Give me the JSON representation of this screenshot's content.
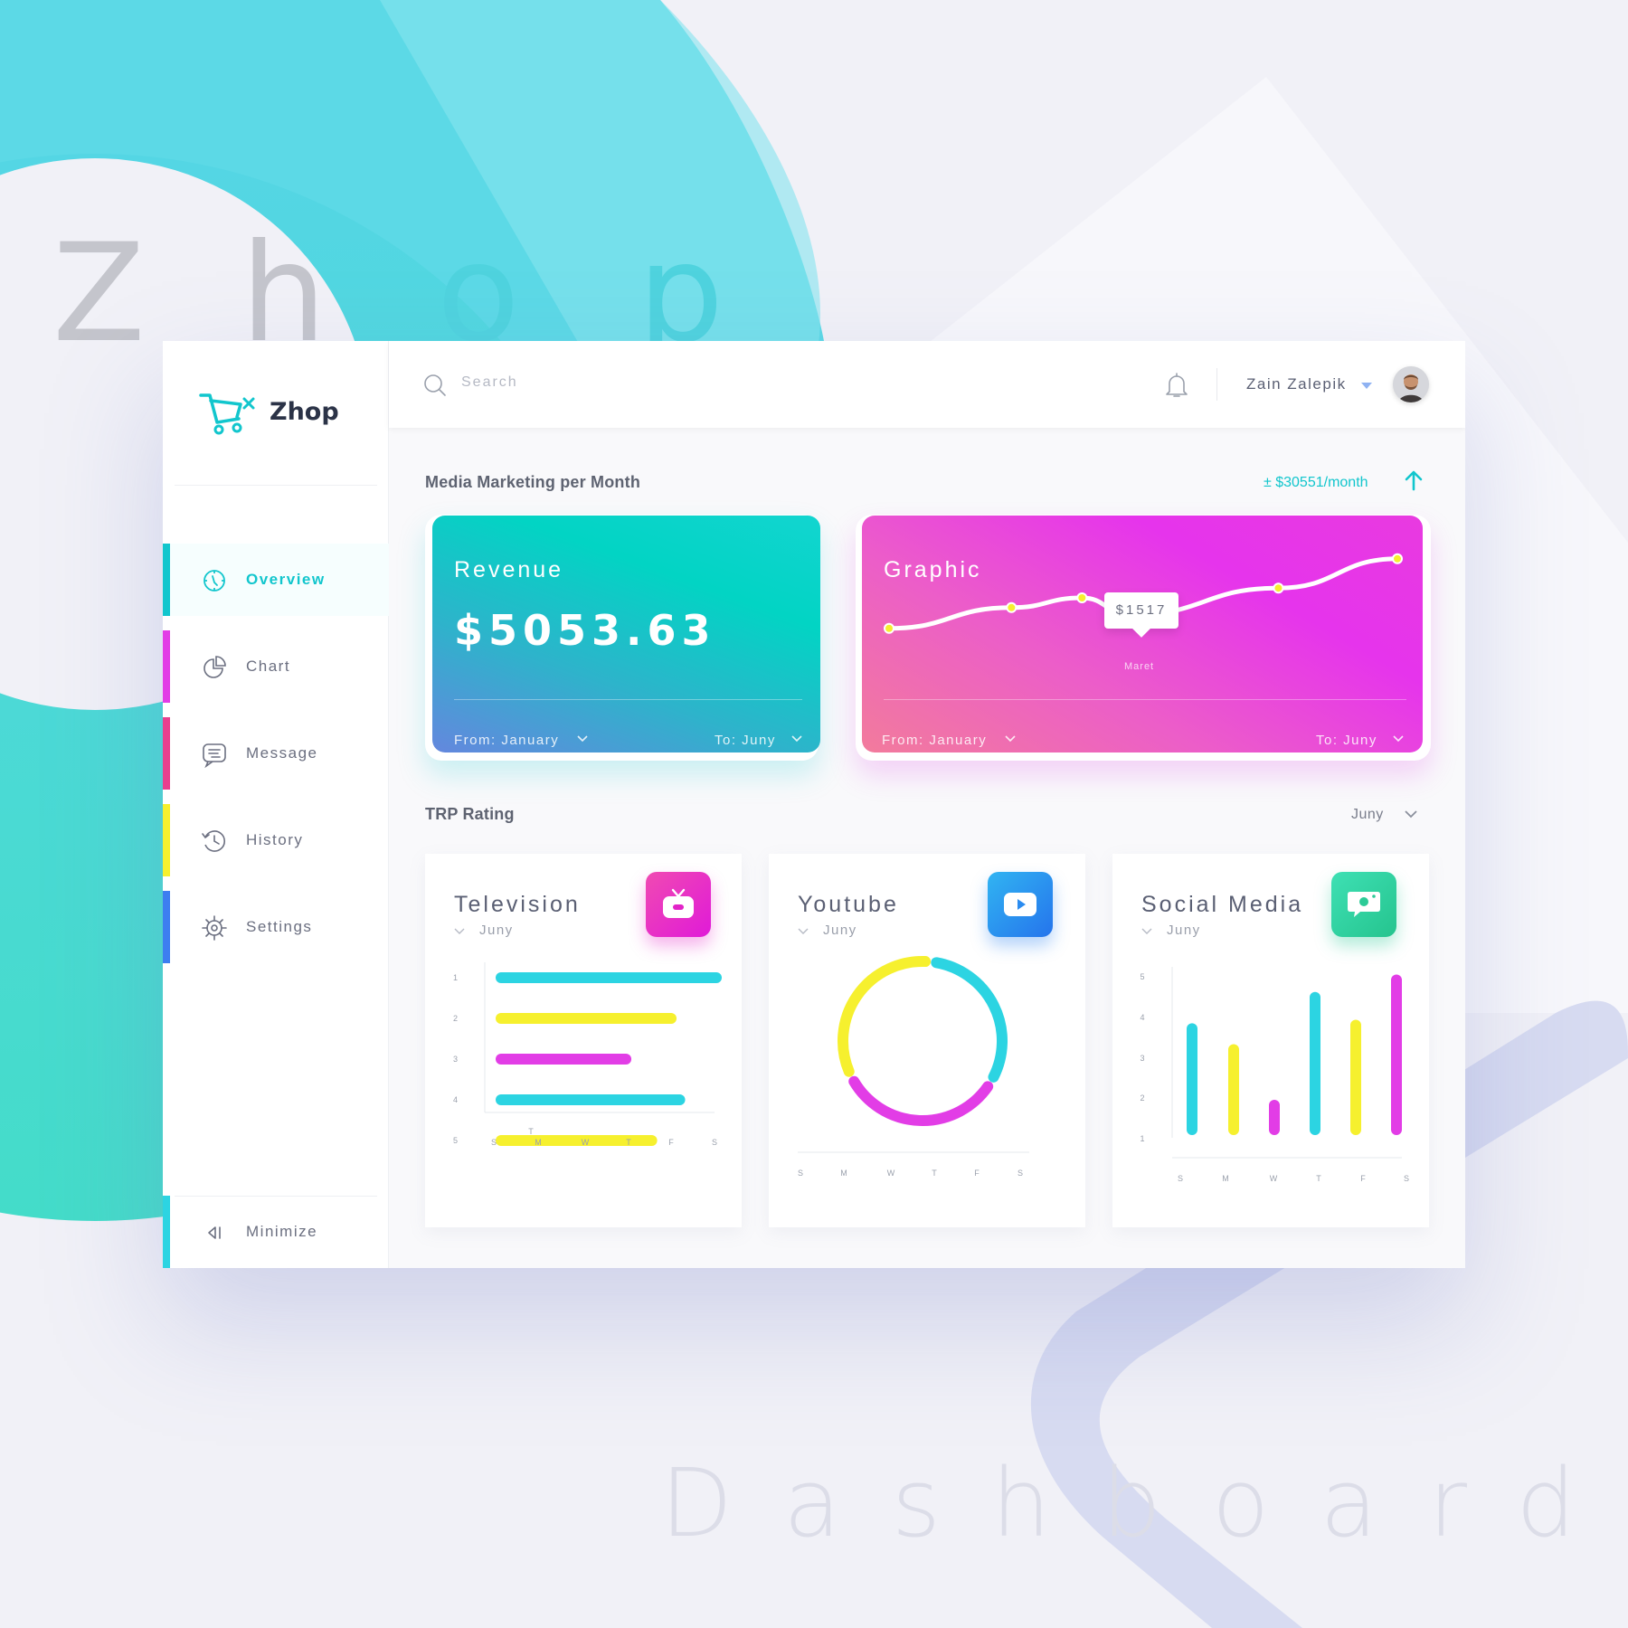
{
  "backdrop": {
    "brand_letters": [
      "Z",
      "h",
      "o",
      "p"
    ],
    "caption": "Dashboard"
  },
  "sidebar": {
    "logo_text": "Zhop",
    "items": [
      {
        "label": "Overview",
        "icon": "clock-compass-icon",
        "color": "#12c6cd",
        "active": true
      },
      {
        "label": "Chart",
        "icon": "pie-chart-icon",
        "color": "#e23de6",
        "active": false
      },
      {
        "label": "Message",
        "icon": "message-icon",
        "color": "#e8408e",
        "active": false
      },
      {
        "label": "History",
        "icon": "history-icon",
        "color": "#f6f02e",
        "active": false
      },
      {
        "label": "Settings",
        "icon": "settings-icon",
        "color": "#3d7ef0",
        "active": false
      }
    ],
    "minimize_label": "Minimize",
    "minimize_color": "#2cd4e2"
  },
  "header": {
    "search_placeholder": "Search",
    "user_name": "Zain Zalepik"
  },
  "marketing": {
    "title": "Media Marketing per Month",
    "monthly_value": "± $30551/month",
    "revenue": {
      "title": "Revenue",
      "value": "$5053.63",
      "from": "From: January",
      "to": "To: Juny"
    },
    "graphic": {
      "title": "Graphic",
      "tooltip": "$1517",
      "point_label": "Maret",
      "from": "From: January",
      "to": "To: Juny",
      "chart_data": {
        "type": "line",
        "points": [
          0.15,
          0.32,
          0.4,
          0.26,
          0.48,
          0.72
        ],
        "highlight_index": 2
      }
    }
  },
  "trp": {
    "title": "TRP Rating",
    "filter": "Juny",
    "colors": {
      "cyan": "#2cd4e2",
      "yellow": "#f6f02e",
      "magenta": "#e23de6",
      "icon_tv": "#e22fc5",
      "icon_youtube": "#2b9cf0",
      "icon_social": "#34d3a0"
    },
    "cards": {
      "television": {
        "title": "Television",
        "sub": "Juny",
        "icon": "tv-icon",
        "chart_data": {
          "type": "bar",
          "orientation": "horizontal",
          "categories": [
            "1",
            "2",
            "3",
            "4",
            "5"
          ],
          "values": [
            100,
            79,
            58,
            83,
            70
          ],
          "colors": [
            "cyan",
            "yellow",
            "magenta",
            "cyan",
            "yellow"
          ],
          "x_ticks": [
            "S",
            "M",
            "W",
            "T",
            "F",
            "S"
          ],
          "extra_tick": "T"
        }
      },
      "youtube": {
        "title": "Youtube",
        "sub": "Juny",
        "icon": "play-icon",
        "chart_data": {
          "type": "pie",
          "variant": "donut",
          "slices": [
            {
              "color": "cyan",
              "value": 30
            },
            {
              "color": "magenta",
              "value": 32
            },
            {
              "color": "yellow",
              "value": 32
            }
          ],
          "x_ticks": [
            "S",
            "M",
            "W",
            "T",
            "F",
            "S"
          ]
        }
      },
      "social": {
        "title": "Social Media",
        "sub": "Juny",
        "icon": "camera-icon",
        "chart_data": {
          "type": "bar",
          "orientation": "vertical",
          "y_ticks": [
            "5",
            "4",
            "3",
            "2",
            "1"
          ],
          "categories": [
            "S",
            "M",
            "W",
            "T",
            "F",
            "S"
          ],
          "values": [
            2.9,
            2.3,
            0.7,
            3.8,
            3.0,
            4.3
          ],
          "colors": [
            "cyan",
            "yellow",
            "magenta",
            "cyan",
            "yellow",
            "magenta"
          ],
          "ylim": [
            0,
            5
          ]
        }
      }
    }
  }
}
